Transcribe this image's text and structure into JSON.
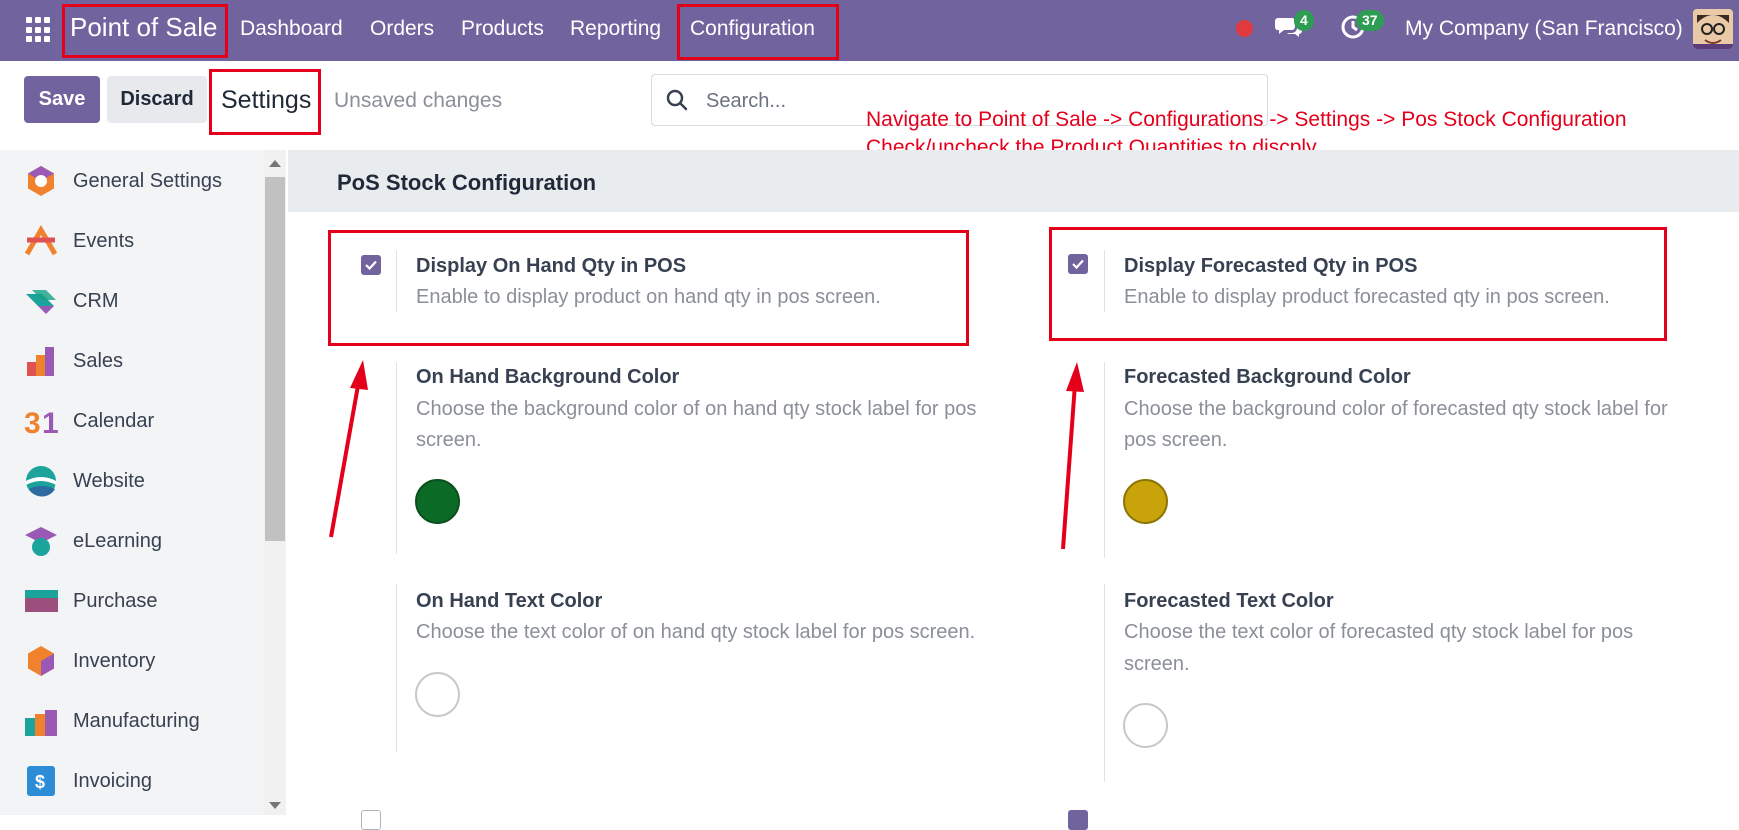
{
  "topbar": {
    "app_name": "Point of Sale",
    "menu": [
      "Dashboard",
      "Orders",
      "Products",
      "Reporting",
      "Configuration"
    ],
    "messages_count": "4",
    "activities_count": "37",
    "company": "My Company (San Francisco)"
  },
  "control": {
    "save_label": "Save",
    "discard_label": "Discard",
    "title": "Settings",
    "status": "Unsaved changes",
    "search_placeholder": "Search..."
  },
  "annotation": {
    "line1": "Navigate to Point of Sale -> Configurations -> Settings -> Pos Stock Configuration",
    "line2": "Check/uncheck the Product Quantities to discply"
  },
  "sidebar": {
    "items": [
      {
        "label": "General Settings",
        "icon": "general-settings-icon"
      },
      {
        "label": "Events",
        "icon": "events-icon"
      },
      {
        "label": "CRM",
        "icon": "crm-icon"
      },
      {
        "label": "Sales",
        "icon": "sales-icon"
      },
      {
        "label": "Calendar",
        "icon": "calendar-icon"
      },
      {
        "label": "Website",
        "icon": "website-icon"
      },
      {
        "label": "eLearning",
        "icon": "elearning-icon"
      },
      {
        "label": "Purchase",
        "icon": "purchase-icon"
      },
      {
        "label": "Inventory",
        "icon": "inventory-icon"
      },
      {
        "label": "Manufacturing",
        "icon": "manufacturing-icon"
      },
      {
        "label": "Invoicing",
        "icon": "invoicing-icon"
      }
    ]
  },
  "section": {
    "title": "PoS Stock Configuration",
    "left": {
      "display_title": "Display On Hand Qty in POS",
      "display_desc": "Enable to display product on hand qty in pos screen.",
      "display_checked": true,
      "bg_title": "On Hand Background Color",
      "bg_desc_1": "Choose the background color of on hand qty stock label for pos",
      "bg_desc_2": "screen.",
      "bg_color": "#0b6b26",
      "text_title": "On Hand Text Color",
      "text_desc": "Choose the text color of on hand qty stock label for pos screen.",
      "text_color": "#ffffff"
    },
    "right": {
      "display_title": "Display Forecasted Qty in POS",
      "display_desc": "Enable to display product forecasted qty in pos screen.",
      "display_checked": true,
      "bg_title": "Forecasted Background Color",
      "bg_desc_1": "Choose the background color of forecasted qty stock label for",
      "bg_desc_2": "pos screen.",
      "bg_color": "#c8a40a",
      "text_title": "Forecasted Text Color",
      "text_desc_1": "Choose the text color of forecasted qty stock label for pos",
      "text_desc_2": "screen.",
      "text_color": "#ffffff"
    }
  }
}
